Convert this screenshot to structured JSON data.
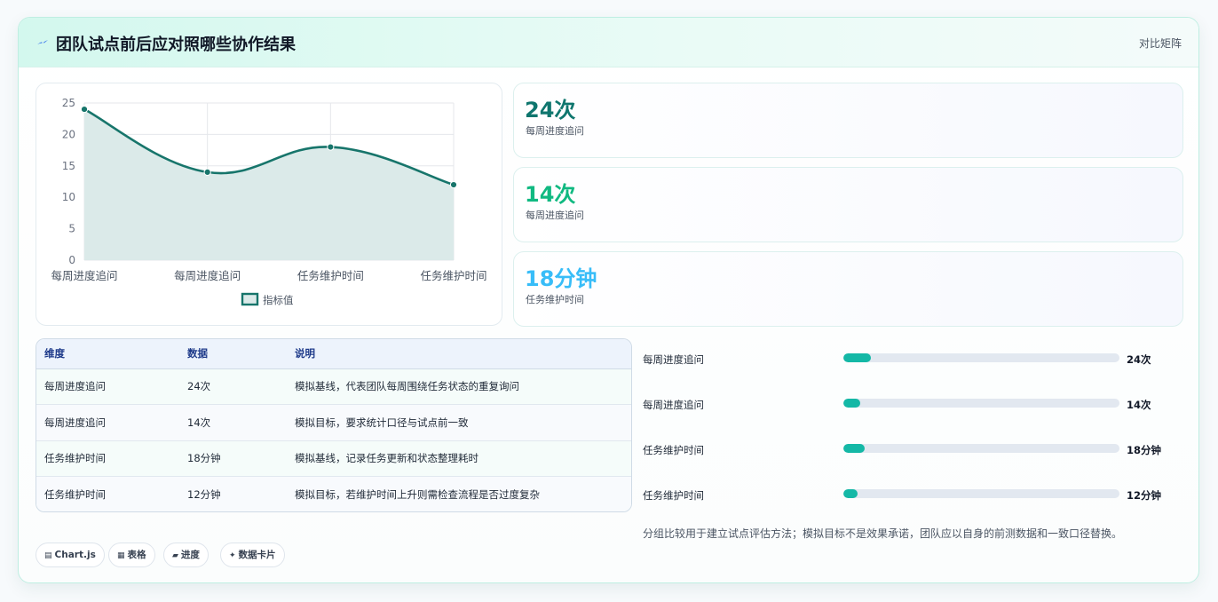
{
  "header": {
    "icon": "sparkle-icon",
    "title": "团队试点前后应对照哪些协作结果",
    "link": "对比矩阵"
  },
  "chart_data": {
    "type": "line",
    "categories": [
      "每周进度追问",
      "每周进度追问",
      "任务维护时间",
      "任务维护时间"
    ],
    "series": [
      {
        "name": "指标值",
        "values": [
          24,
          14,
          18,
          12
        ]
      }
    ],
    "yticks": [
      "0",
      "5",
      "10",
      "15",
      "20",
      "25"
    ],
    "ylim": [
      0,
      25
    ],
    "grid": true,
    "area_fill": true,
    "smooth": true,
    "legend": "bottom",
    "line_color": "#17756b",
    "fill_color": "#dbeae9"
  },
  "stats": [
    {
      "value": "24次",
      "label": "每周进度追问",
      "color": "#0f766e"
    },
    {
      "value": "14次",
      "label": "每周进度追问",
      "color": "#10b981"
    },
    {
      "value": "18分钟",
      "label": "任务维护时间",
      "color": "#38bdf8"
    }
  ],
  "table": {
    "headers": [
      "维度",
      "数据",
      "说明"
    ],
    "rows": [
      [
        "每周进度追问",
        "24次",
        "模拟基线，代表团队每周围绕任务状态的重复询问"
      ],
      [
        "每周进度追问",
        "14次",
        "模拟目标，要求统计口径与试点前一致"
      ],
      [
        "任务维护时间",
        "18分钟",
        "模拟基线，记录任务更新和状态整理耗时"
      ],
      [
        "任务维护时间",
        "12分钟",
        "模拟目标，若维护时间上升则需检查流程是否过度复杂"
      ]
    ]
  },
  "progress": [
    {
      "label": "每周进度追问",
      "value": "24次",
      "fraction": 0.1
    },
    {
      "label": "每周进度追问",
      "value": "14次",
      "fraction": 0.06
    },
    {
      "label": "任务维护时间",
      "value": "18分钟",
      "fraction": 0.077
    },
    {
      "label": "任务维护时间",
      "value": "12分钟",
      "fraction": 0.05
    }
  ],
  "note": "分组比较用于建立试点评估方法；模拟目标不是效果承诺，团队应以自身的前测数据和一致口径替换。",
  "tags": [
    {
      "icon": "chart-icon",
      "glyph": "▤",
      "label": "Chart.js"
    },
    {
      "icon": "table-icon",
      "glyph": "▦",
      "label": "表格"
    },
    {
      "icon": "progress-icon",
      "glyph": "▰",
      "label": "进度"
    },
    {
      "icon": "card-icon",
      "glyph": "✦",
      "label": "数据卡片"
    }
  ]
}
